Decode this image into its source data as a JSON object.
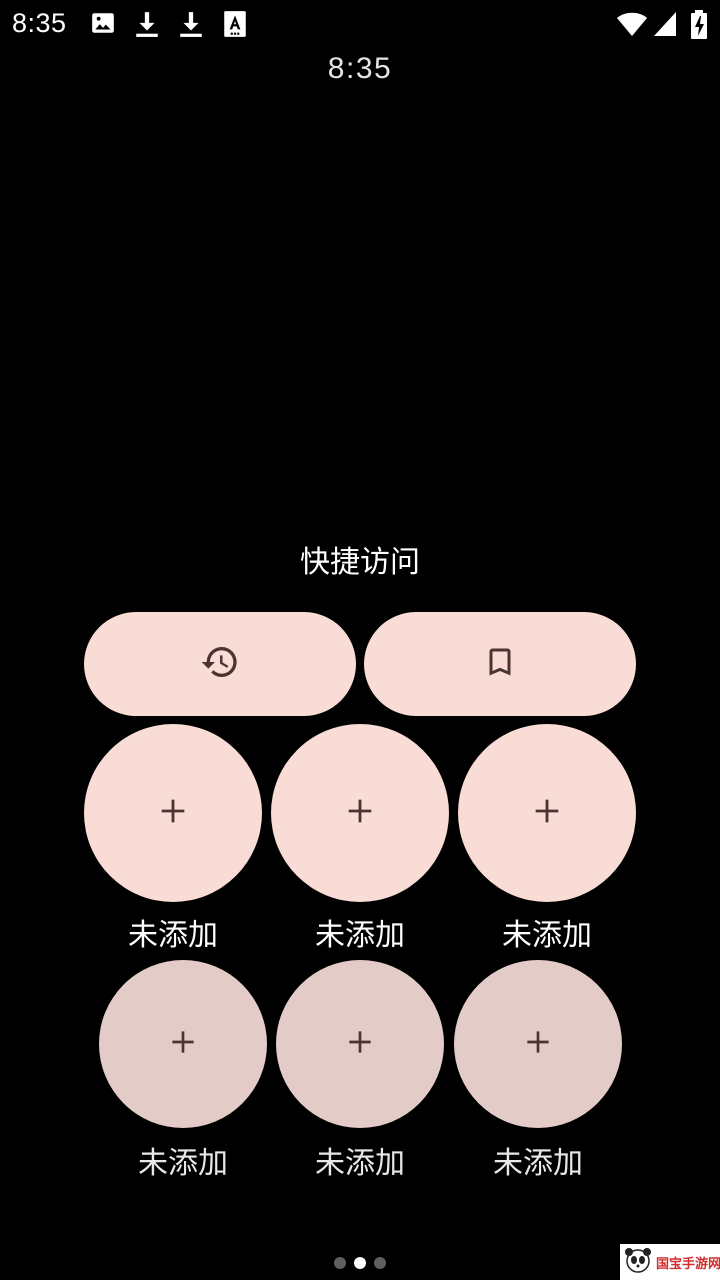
{
  "status_bar": {
    "time": "8:35",
    "left_icons": [
      "image-icon",
      "download-icon",
      "download-icon",
      "text-recognition-icon"
    ],
    "right_icons": [
      "wifi-icon",
      "cell-signal-icon",
      "battery-charging-icon"
    ]
  },
  "clock": {
    "time": "8:35"
  },
  "quick_access": {
    "title": "快捷访问",
    "pills": [
      {
        "icon": "history-icon"
      },
      {
        "icon": "bookmark-icon"
      }
    ],
    "row1": [
      {
        "icon": "plus-icon",
        "label": "未添加"
      },
      {
        "icon": "plus-icon",
        "label": "未添加"
      },
      {
        "icon": "plus-icon",
        "label": "未添加"
      }
    ],
    "row2": [
      {
        "icon": "plus-icon",
        "label": "未添加"
      },
      {
        "icon": "plus-icon",
        "label": "未添加"
      },
      {
        "icon": "plus-icon",
        "label": "未添加"
      }
    ]
  },
  "pager": {
    "count": 3,
    "active_index": 1
  },
  "watermark": {
    "text": "国宝手游网"
  },
  "colors": {
    "background": "#000000",
    "pill": "#fadcd6",
    "circle_row1": "#fadcd6",
    "circle_row2": "#e3ccc7",
    "icon": "#4a3532"
  }
}
